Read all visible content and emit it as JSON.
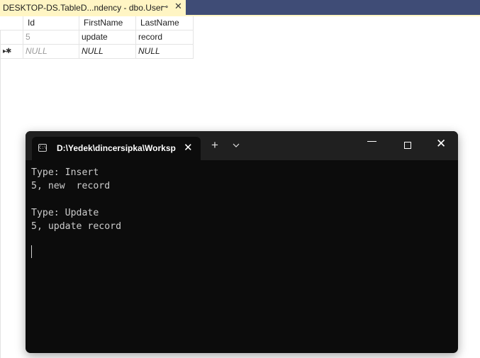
{
  "document_tab": {
    "title": "DESKTOP-DS.TableD...ndency - dbo.User",
    "pin_glyph": "⊸",
    "close_glyph": "✕"
  },
  "grid": {
    "columns": [
      "Id",
      "FirstName",
      "LastName"
    ],
    "rows": [
      {
        "selector": "",
        "Id": "5",
        "FirstName": "update",
        "LastName": "record"
      },
      {
        "selector": "▸✱",
        "Id": "NULL",
        "FirstName": "NULL",
        "LastName": "NULL"
      }
    ]
  },
  "terminal": {
    "tab_title": "D:\\Yedek\\dincersipka\\Worksp",
    "tab_icon": "terminal-icon",
    "tab_close": "✕",
    "new_tab": "+",
    "dropdown": "⌄",
    "close": "✕",
    "lines": [
      "Type: Insert",
      "5, new  record",
      "",
      "Type: Update",
      "5, update record"
    ]
  }
}
